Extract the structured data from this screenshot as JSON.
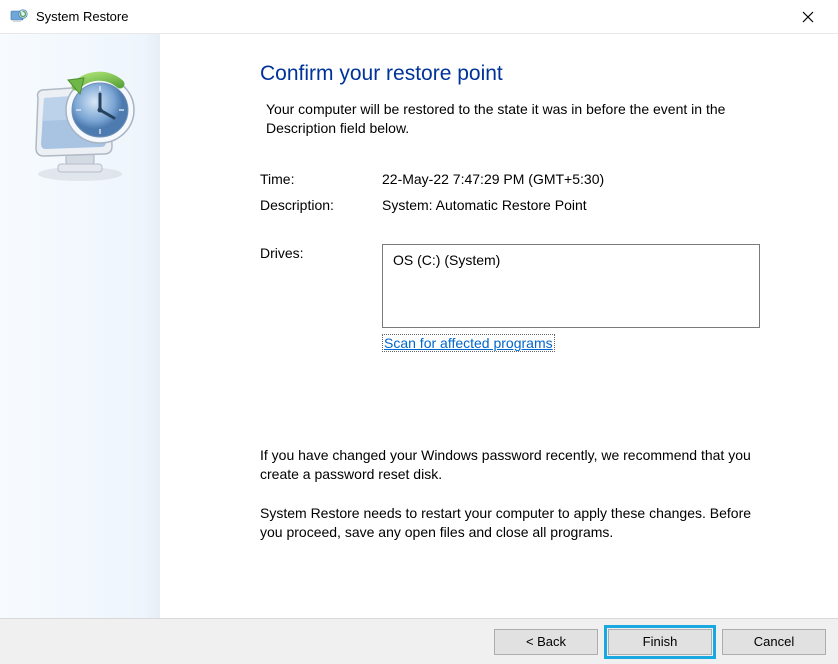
{
  "window": {
    "title": "System Restore"
  },
  "main": {
    "heading": "Confirm your restore point",
    "subtext": "Your computer will be restored to the state it was in before the event in the Description field below.",
    "rows": {
      "time_label": "Time:",
      "time_value": "22-May-22 7:47:29 PM (GMT+5:30)",
      "description_label": "Description:",
      "description_value": "System: Automatic Restore Point",
      "drives_label": "Drives:",
      "drives_value": "OS (C:) (System)"
    },
    "scan_link": "Scan for affected programs",
    "note1": "If you have changed your Windows password recently, we recommend that you create a password reset disk.",
    "note2": "System Restore needs to restart your computer to apply these changes. Before you proceed, save any open files and close all programs."
  },
  "buttons": {
    "back": "< Back",
    "finish": "Finish",
    "cancel": "Cancel"
  }
}
